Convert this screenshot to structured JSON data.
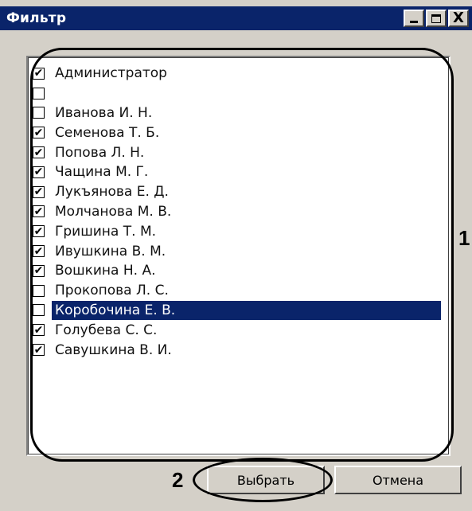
{
  "window": {
    "title": "Фильтр"
  },
  "titlebar_buttons": {
    "close_glyph": "X"
  },
  "list": [
    {
      "label": "Администратор",
      "checked": true
    },
    {
      "label": "",
      "checked": false
    },
    {
      "label": "Иванова И. Н.",
      "checked": false
    },
    {
      "label": "Семенова Т. Б.",
      "checked": true
    },
    {
      "label": "Попова Л. Н.",
      "checked": true
    },
    {
      "label": "Чащина М. Г.",
      "checked": true
    },
    {
      "label": "Лукъянова Е. Д.",
      "checked": true
    },
    {
      "label": "Молчанова М. В.",
      "checked": true
    },
    {
      "label": "Гришина Т. М.",
      "checked": true
    },
    {
      "label": "Ивушкина В. М.",
      "checked": true
    },
    {
      "label": "Вошкина Н. А.",
      "checked": true
    },
    {
      "label": "Прокопова Л. С.",
      "checked": false
    },
    {
      "label": "Коробочина Е. В.",
      "checked": false,
      "selected": true
    },
    {
      "label": "Голубева С. С.",
      "checked": true
    },
    {
      "label": "Савушкина В. И.",
      "checked": true
    }
  ],
  "buttons": {
    "ok_label": "Выбрать",
    "cancel_label": "Отмена"
  },
  "annotations": {
    "list_marker": "1",
    "button_marker": "2"
  },
  "colors": {
    "titlebar": "#0a246a",
    "selection": "#0a246a",
    "face": "#d4d0c8"
  },
  "icons": {
    "check": "check-icon",
    "minimize": "minimize-icon",
    "maximize": "maximize-icon",
    "close": "close-icon"
  }
}
